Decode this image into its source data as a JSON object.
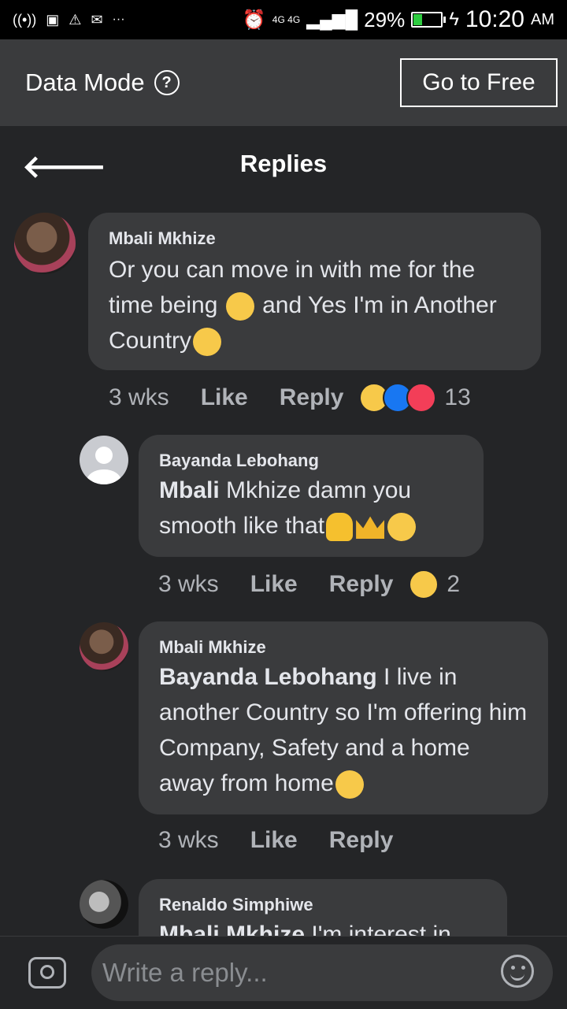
{
  "status_bar": {
    "network": "4G 4G",
    "battery": "29%",
    "battery_level": 0.29,
    "time": "10:20",
    "ampm": "AM"
  },
  "data_mode": {
    "label": "Data Mode",
    "help_icon": "?",
    "go_free": "Go to Free"
  },
  "header": {
    "title": "Replies",
    "back_icon": "🡐"
  },
  "comments": [
    {
      "author": "Mbali Mkhize",
      "text": "Or you can move in with me for the time being",
      "text2": " and Yes I'm in Another Country",
      "time": "3 wks",
      "like": "Like",
      "reply": "Reply",
      "reactions": "13"
    },
    {
      "author": "Bayanda Lebohang",
      "mention": "Mbali",
      "text": " Mkhize damn you smooth like that",
      "time": "3 wks",
      "like": "Like",
      "reply": "Reply",
      "reactions": "2"
    },
    {
      "author": "Mbali Mkhize",
      "mention": "Bayanda Lebohang",
      "text": " I live in another Country so I'm offering him Company, Safety and a home away from home",
      "time": "3 wks",
      "like": "Like",
      "reply": "Reply"
    },
    {
      "author": "Renaldo Simphiwe",
      "mention": "Mbali Mkhize",
      "text": " I'm interest in"
    }
  ],
  "composer": {
    "placeholder": "Write a reply..."
  }
}
